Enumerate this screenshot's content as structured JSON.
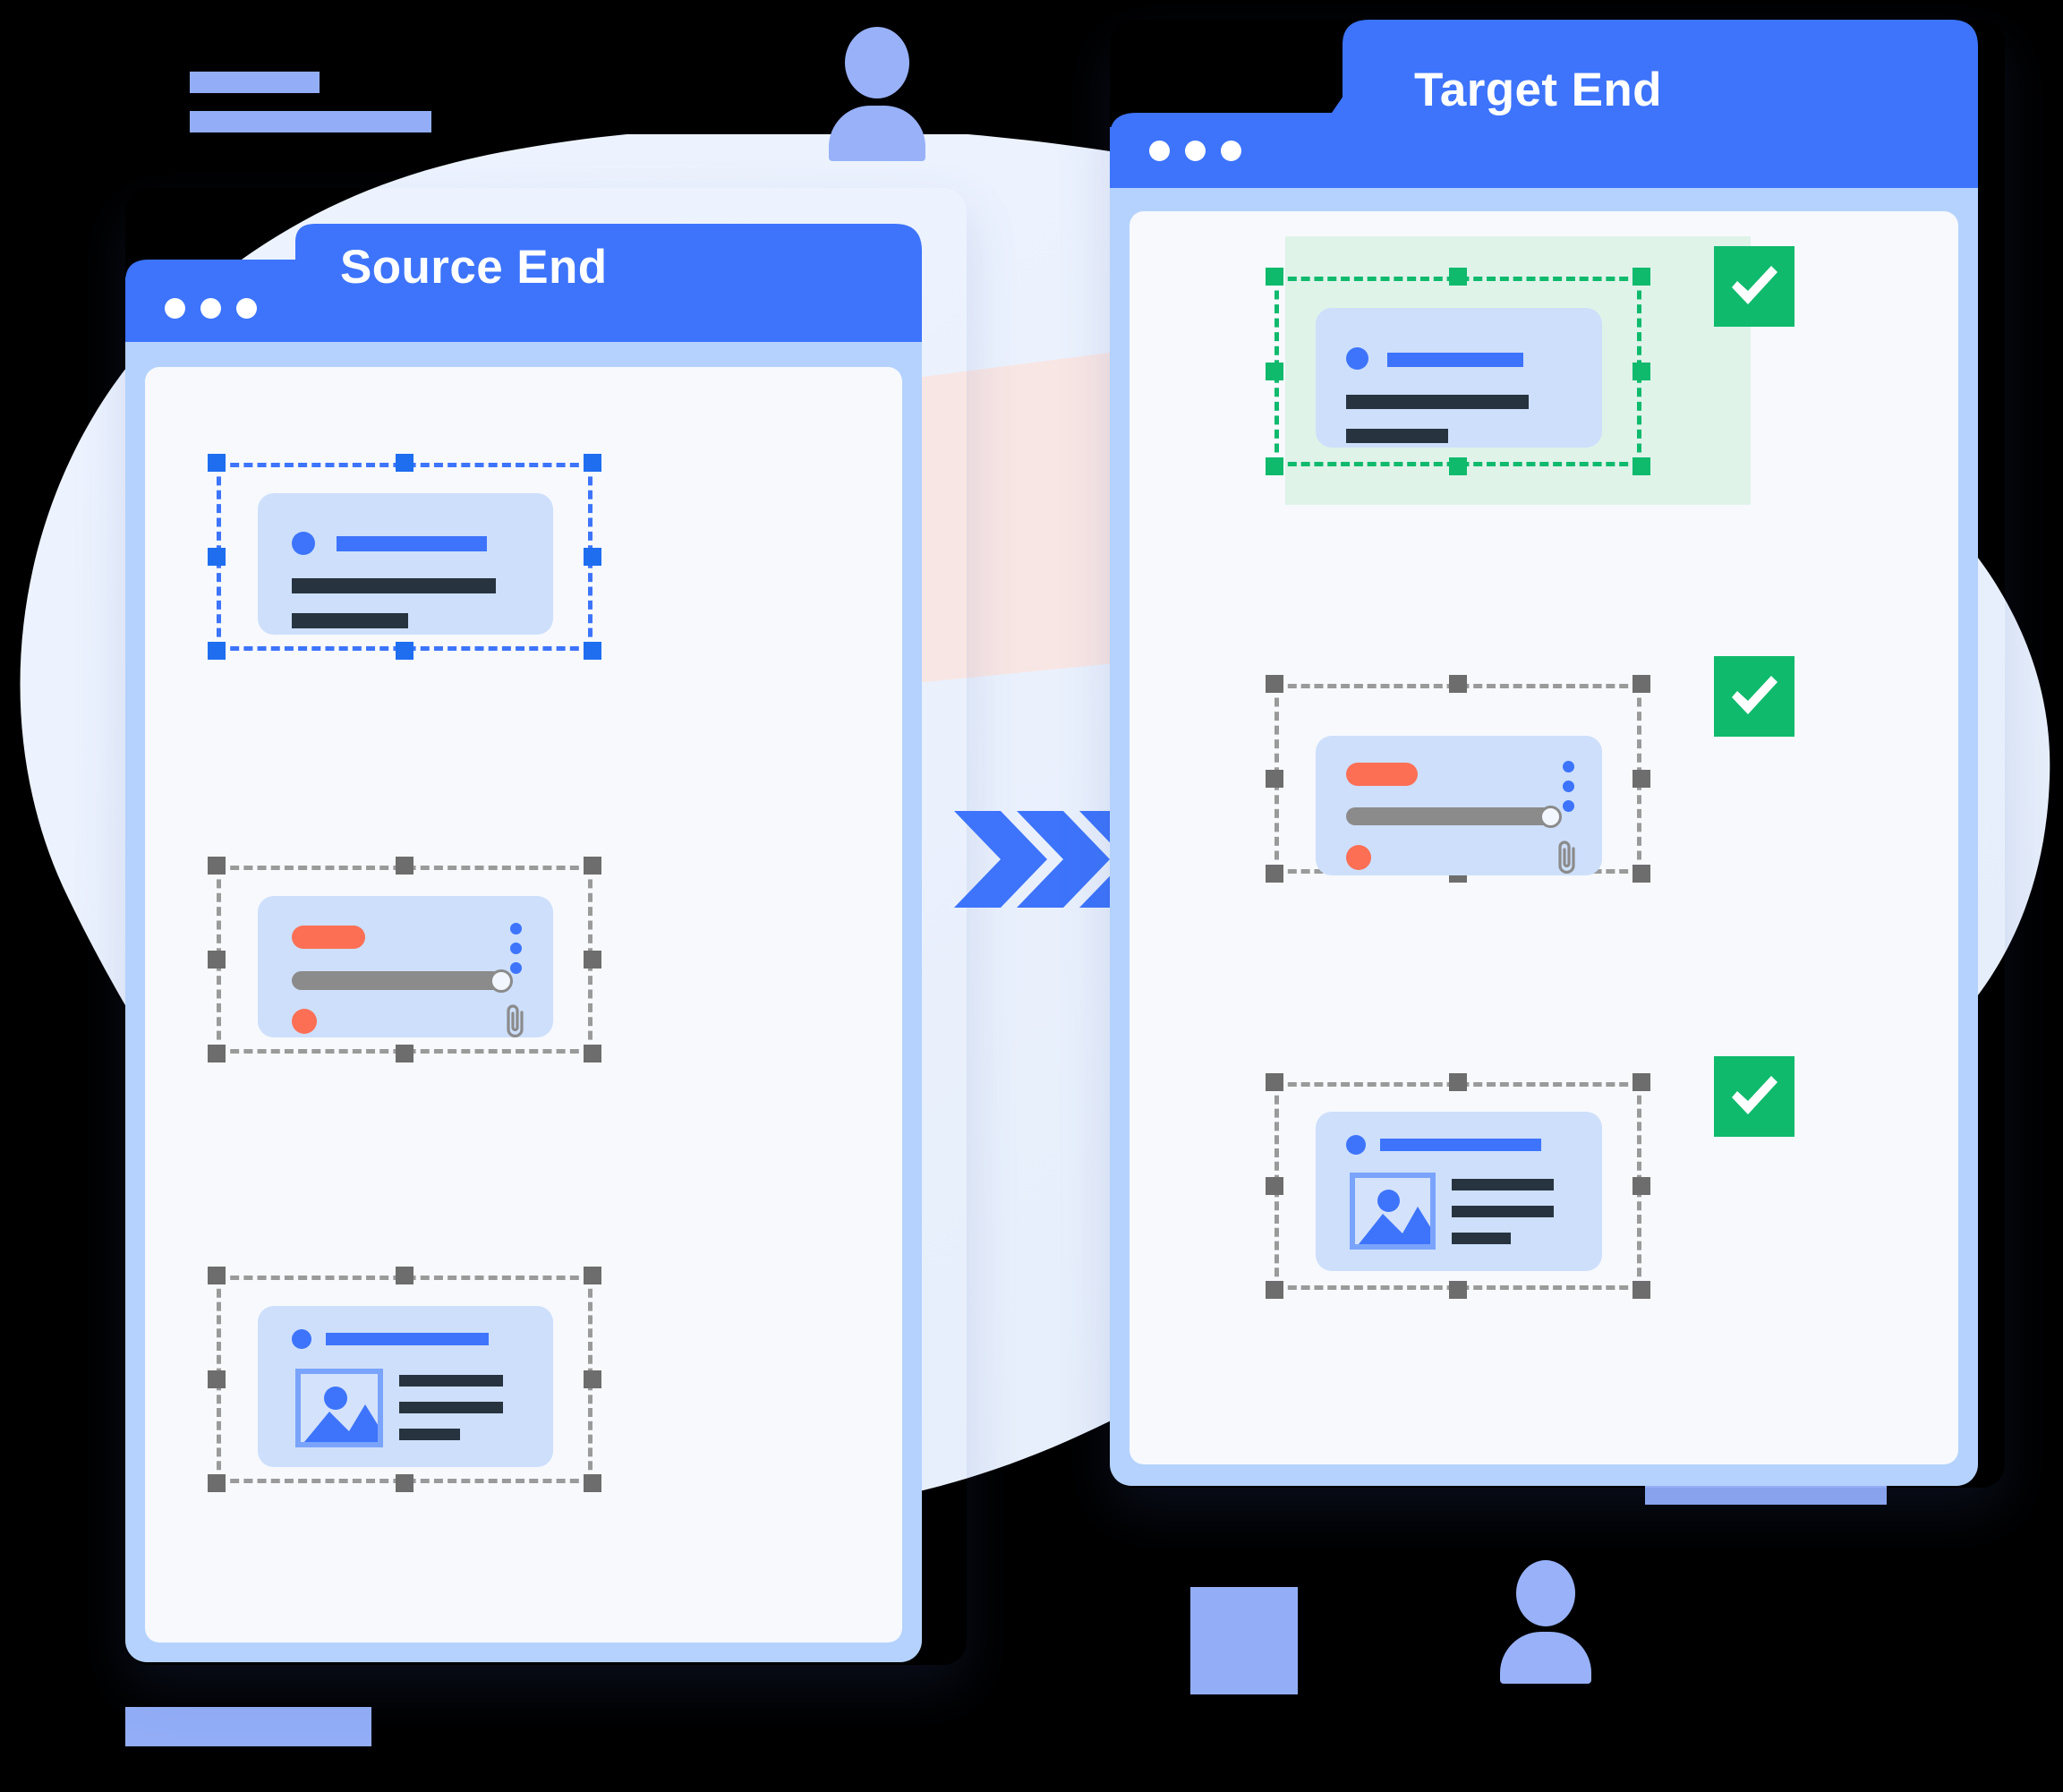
{
  "illustration": {
    "type": "data-migration-diagram",
    "theme_colors": {
      "primary_blue": "#3d74fb",
      "light_blue_card": "#cddffb",
      "pale_blue_body": "#b4d2fd",
      "canvas": "#f7f9fd",
      "dark_text_bar": "#273440",
      "coral": "#fc6f55",
      "gray": "#8b8b8b",
      "success_green": "#0fba6d",
      "green_highlight": "#dff3e9",
      "beam_pink": "#f7e4e3",
      "decor_blue": "#93aef7"
    }
  },
  "source_window": {
    "title": "Source End",
    "traffic_lights": [
      "dot",
      "dot",
      "dot"
    ],
    "selection_state": "selected",
    "selection_color": "#3d74fb",
    "cards": [
      {
        "id": "source-card-1",
        "kind": "text-card",
        "selected": true,
        "selection_style": "blue-dashed",
        "elements": [
          "bullet-dot",
          "title-bar-blue",
          "text-bar-long",
          "text-bar-short"
        ]
      },
      {
        "id": "source-card-2",
        "kind": "progress-card",
        "selected": false,
        "selection_style": "gray-dashed",
        "elements": [
          "tag-pill-coral",
          "progress-slider",
          "status-dot-coral",
          "kebab-menu",
          "attachment-icon"
        ],
        "progress_percent": 92
      },
      {
        "id": "source-card-3",
        "kind": "media-card",
        "selected": false,
        "selection_style": "gray-dashed",
        "elements": [
          "bullet-dot",
          "title-bar-blue",
          "image-placeholder",
          "text-bar",
          "text-bar",
          "text-bar-short"
        ]
      }
    ]
  },
  "target_window": {
    "title": "Target End",
    "traffic_lights": [
      "dot",
      "dot",
      "dot"
    ],
    "cards": [
      {
        "id": "target-card-1",
        "kind": "text-card",
        "status": "synced",
        "status_icon": "check-mark",
        "selection_style": "green-dashed",
        "highlighted": true,
        "elements": [
          "bullet-dot",
          "title-bar-blue",
          "text-bar-long",
          "text-bar-short"
        ]
      },
      {
        "id": "target-card-2",
        "kind": "progress-card",
        "status": "synced",
        "status_icon": "check-mark",
        "selection_style": "gray-dashed",
        "elements": [
          "tag-pill-coral",
          "progress-slider",
          "status-dot-coral",
          "kebab-menu",
          "attachment-icon"
        ],
        "progress_percent": 92
      },
      {
        "id": "target-card-3",
        "kind": "media-card",
        "status": "synced",
        "status_icon": "check-mark",
        "selection_style": "gray-dashed",
        "elements": [
          "bullet-dot",
          "title-bar-blue",
          "image-placeholder",
          "text-bar",
          "text-bar",
          "text-bar-short"
        ]
      }
    ]
  },
  "transfer": {
    "direction": "source-to-target",
    "arrow_icon": "triple-chevron-right",
    "chevron_count": 3,
    "beam_label": ""
  },
  "decorations": {
    "top_left_bars": 2,
    "bottom_left_bar": 1,
    "bottom_right_bar": 1,
    "person_icons": 2,
    "square_icon": 1
  }
}
